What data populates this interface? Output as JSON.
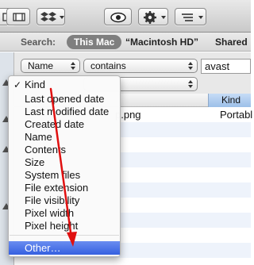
{
  "toolbar": {
    "icons": [
      "view-columns-icon",
      "cover-flow-icon",
      "dropbox-icon",
      "quick-look-icon",
      "action-gear-icon",
      "arrange-icon"
    ]
  },
  "scope": {
    "label": "Search:",
    "this_mac": "This Mac",
    "macintosh_hd": "“Macintosh HD”",
    "shared": "Shared"
  },
  "criteria": {
    "attribute": "Name",
    "operator": "contains",
    "value": "avast"
  },
  "list": {
    "kind_header": "Kind",
    "rows": [
      {
        "name": "p.png",
        "kind": "Portabl"
      }
    ]
  },
  "menu": {
    "checkmark": "✓",
    "items": [
      "Kind",
      "Last opened date",
      "Last modified date",
      "Created date",
      "Name",
      "Contents",
      "Size",
      "System files",
      "File extension",
      "File visibility",
      "Pixel width",
      "Pixel height"
    ],
    "other": "Other…"
  },
  "annotation": {
    "arrow_color": "#e01010"
  }
}
